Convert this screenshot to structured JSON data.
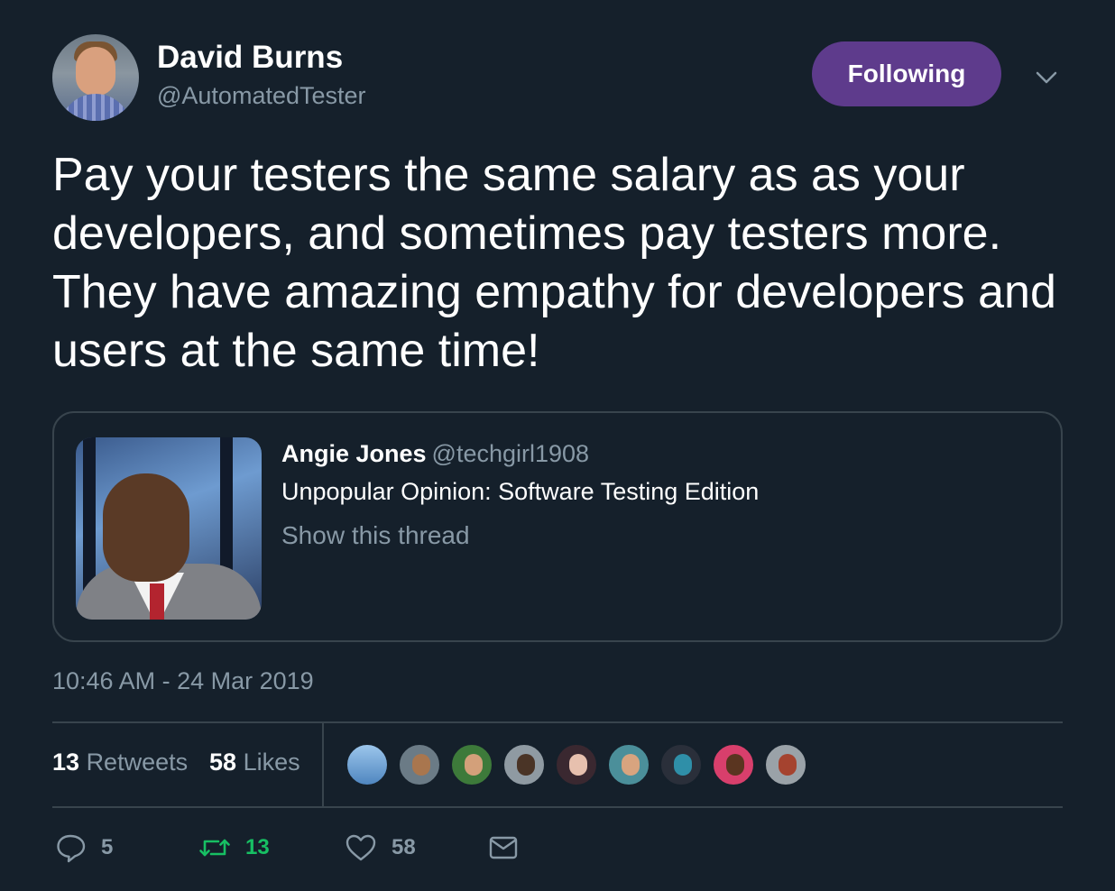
{
  "author": {
    "name": "David Burns",
    "handle": "@AutomatedTester",
    "avatar_icon": "user-avatar"
  },
  "header": {
    "follow_label": "Following",
    "follow_color": "#5e3b8c",
    "menu_icon": "chevron-down-icon"
  },
  "tweet": {
    "text": "Pay your testers the same salary as as your developers, and sometimes pay testers more. They have amazing empathy for developers and users at the same time!"
  },
  "quoted": {
    "name": "Angie Jones",
    "handle": "@techgirl1908",
    "text": "Unpopular Opinion: Software Testing Edition",
    "link_label": "Show this thread",
    "image_icon": "quoted-tweet-image"
  },
  "timestamp": "10:46 AM - 24 Mar 2019",
  "stats": {
    "retweets_count": "13",
    "retweets_label": "Retweets",
    "likes_count": "58",
    "likes_label": "Likes",
    "liker_avatar_count": 9
  },
  "actions": {
    "reply_count": "5",
    "retweet_count": "13",
    "like_count": "58",
    "retweet_active_color": "#17bf63"
  },
  "colors": {
    "background": "#15202b",
    "muted_text": "#8899a6",
    "border": "#38444d"
  }
}
